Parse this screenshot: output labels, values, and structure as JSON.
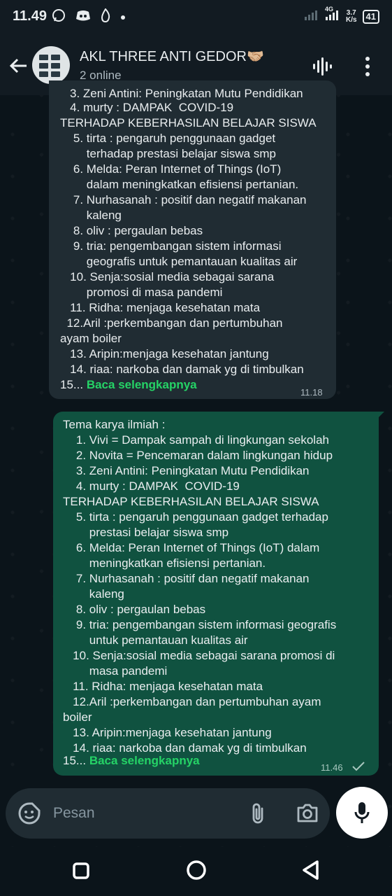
{
  "status_bar": {
    "time": "11.49",
    "network": "4G",
    "speed_value": "3.7",
    "speed_unit": "K/s",
    "battery": "41"
  },
  "header": {
    "title": "AKL THREE ANTI GEDOR🤝🏼",
    "subtitle": "2 online",
    "icons": [
      "back-arrow-icon",
      "voice-call-icon",
      "more-options-icon"
    ]
  },
  "incoming_message": {
    "clipped_top_line": "3. Zeni Antini: Peningkatan Mutu Pendidikan",
    "lines": [
      "   4. murty : DAMPAK  COVID-19",
      "TERHADAP KEBERHASILAN BELAJAR SISWA",
      "    5. tirta : pengaruh penggunaan gadget",
      "        terhadap prestasi belajar siswa smp",
      "    6. Melda: Peran Internet of Things (IoT)",
      "        dalam meningkatkan efisiensi pertanian.",
      "    7. Nurhasanah : positif dan negatif makanan",
      "        kaleng",
      "    8. oliv : pergaulan bebas",
      "    9. tria: pengembangan sistem informasi",
      "        geografis untuk pemantauan kualitas air",
      "   10. Senja:sosial media sebagai sarana",
      "        promosi di masa pandemi",
      "   11. Ridha: menjaga kesehatan mata",
      "  12.Aril :perkembangan dan pertumbuhan",
      "ayam boiler",
      "   13. Aripin:menjaga kesehatan jantung",
      "   14. riaa: narkoba dan damak yg di timbulkan"
    ],
    "last_line_prefix": "15...",
    "read_more": "Baca selengkapnya",
    "time": "11.18"
  },
  "outgoing_message": {
    "lines": [
      "Tema karya ilmiah :",
      "    1. Vivi = Dampak sampah di lingkungan sekolah",
      "    2. Novita = Pencemaran dalam lingkungan hidup",
      "    3. Zeni Antini: Peningkatan Mutu Pendidikan",
      "    4. murty : DAMPAK  COVID-19",
      "TERHADAP KEBERHASILAN BELAJAR SISWA",
      "    5. tirta : pengaruh penggunaan gadget terhadap",
      "        prestasi belajar siswa smp",
      "    6. Melda: Peran Internet of Things (IoT) dalam",
      "        meningkatkan efisiensi pertanian.",
      "    7. Nurhasanah : positif dan negatif makanan",
      "        kaleng",
      "    8. oliv : pergaulan bebas",
      "    9. tria: pengembangan sistem informasi geografis",
      "        untuk pemantauan kualitas air",
      "   10. Senja:sosial media sebagai sarana promosi di",
      "        masa pandemi",
      "   11. Ridha: menjaga kesehatan mata",
      "   12.Aril :perkembangan dan pertumbuhan ayam",
      "boiler",
      "   13. Aripin:menjaga kesehatan jantung",
      "   14. riaa: narkoba dan damak yg di timbulkan"
    ],
    "last_line_prefix": "15...",
    "read_more": "Baca selengkapnya",
    "time": "11.46",
    "status_icon": "single-check-icon"
  },
  "composer": {
    "placeholder": "Pesan",
    "icons": [
      "emoji-sticker-icon",
      "attach-icon",
      "camera-icon",
      "mic-icon"
    ]
  },
  "nav_bar": {
    "icons": [
      "recents-square-icon",
      "home-circle-icon",
      "back-triangle-icon"
    ]
  },
  "colors": {
    "background": "#0b141a",
    "header": "#121b22",
    "incoming_bubble": "#202c33",
    "outgoing_bubble": "#105240",
    "link_green": "#25d366"
  }
}
